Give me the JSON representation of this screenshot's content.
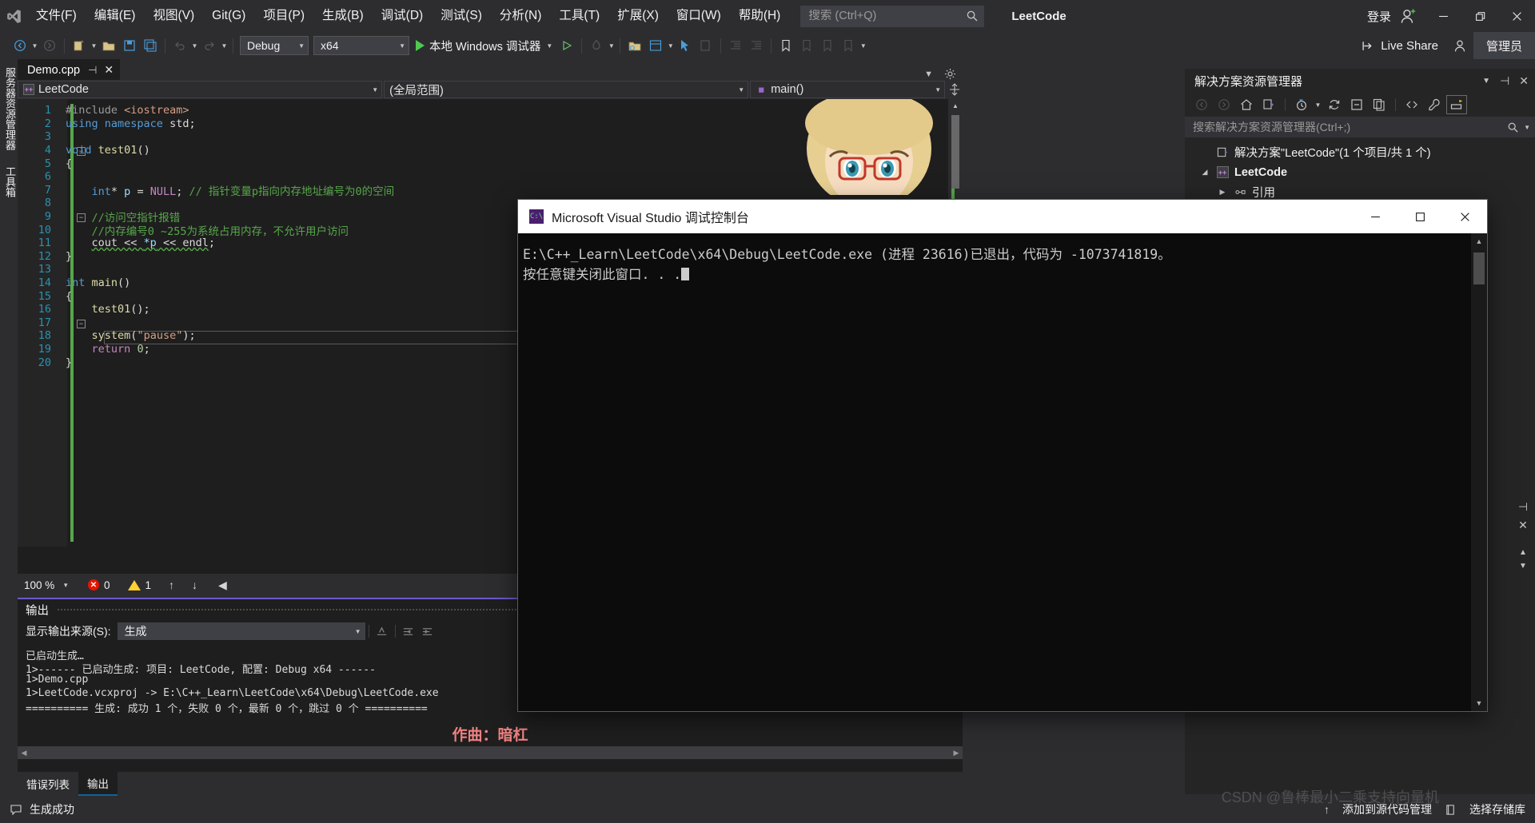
{
  "window": {
    "product": "LeetCode",
    "signin_label": "登录",
    "minimize": "minimize-icon",
    "restore": "restore-icon",
    "close": "close-icon"
  },
  "menubar": {
    "items": [
      {
        "label": "文件(F)"
      },
      {
        "label": "编辑(E)"
      },
      {
        "label": "视图(V)"
      },
      {
        "label": "Git(G)"
      },
      {
        "label": "项目(P)"
      },
      {
        "label": "生成(B)"
      },
      {
        "label": "调试(D)"
      },
      {
        "label": "测试(S)"
      },
      {
        "label": "分析(N)"
      },
      {
        "label": "工具(T)"
      },
      {
        "label": "扩展(X)"
      },
      {
        "label": "窗口(W)"
      },
      {
        "label": "帮助(H)"
      }
    ],
    "search_placeholder": "搜索 (Ctrl+Q)"
  },
  "toolbar": {
    "config": "Debug",
    "platform": "x64",
    "run_label": "本地 Windows 调试器",
    "live_share": "Live Share",
    "admin": "管理员"
  },
  "left_vtabs": [
    {
      "label": "服务器资源管理器"
    },
    {
      "label": "工具箱"
    }
  ],
  "editor": {
    "tab": {
      "name": "Demo.cpp",
      "pin": "pin-icon",
      "close": "close-icon"
    },
    "nav": {
      "project": "LeetCode",
      "scope": "(全局范围)",
      "member": "main()"
    },
    "zoom": "100 %",
    "errors": "0",
    "warnings": "1",
    "code_lines": [
      {
        "n": 1,
        "html": "<span class='pp'>#include</span> <span class='str'>&lt;iostream&gt;</span>"
      },
      {
        "n": 2,
        "html": "<span class='kw'>using</span> <span class='kw'>namespace</span> std;"
      },
      {
        "n": 3,
        "html": ""
      },
      {
        "n": 4,
        "html": "<span class='kw'>void</span> <span class='fn'>test01</span>()"
      },
      {
        "n": 5,
        "html": "{"
      },
      {
        "n": 6,
        "html": ""
      },
      {
        "n": 7,
        "html": "    <span class='kw'>int</span>* <span class='var'>p</span> = <span class='kw2'>NULL</span>; <span class='cmt'>// 指针变量p指向内存地址编号为0的空间</span>"
      },
      {
        "n": 8,
        "html": ""
      },
      {
        "n": 9,
        "html": "    <span class='cmt'>//访问空指针报错</span>"
      },
      {
        "n": 10,
        "html": "    <span class='cmt'>//内存编号0 ~255为系统占用内存，不允许用户访问</span>"
      },
      {
        "n": 11,
        "html": "    <span class='squig'>cout &lt;&lt; <span class='var'>*p</span> &lt;&lt; endl</span>;"
      },
      {
        "n": 12,
        "html": "}"
      },
      {
        "n": 13,
        "html": ""
      },
      {
        "n": 14,
        "html": "<span class='kw'>int</span> <span class='fn'>main</span>()"
      },
      {
        "n": 15,
        "html": "{"
      },
      {
        "n": 16,
        "html": "    <span class='fn'>test01</span>();"
      },
      {
        "n": 17,
        "html": ""
      },
      {
        "n": 18,
        "html": "    <span class='fn'>system</span>(<span class='str'>\"pause\"</span>);"
      },
      {
        "n": 19,
        "html": "    <span class='kw2'>return</span> <span class='num'>0</span>;"
      },
      {
        "n": 20,
        "html": "}"
      }
    ]
  },
  "output": {
    "title": "输出",
    "source_label": "显示输出来源(S):",
    "source_value": "生成",
    "lines": [
      "已启动生成…",
      "1>------ 已启动生成: 项目: LeetCode, 配置: Debug x64 ------",
      "1>Demo.cpp",
      "1>LeetCode.vcxproj -> E:\\C++_Learn\\LeetCode\\x64\\Debug\\LeetCode.exe",
      "========== 生成: 成功 1 个，失败 0 个，最新 0 个，跳过 0 个 =========="
    ],
    "credit": "作曲：暗杠",
    "tabs": [
      {
        "label": "错误列表",
        "active": false
      },
      {
        "label": "输出",
        "active": true
      }
    ]
  },
  "solution_explorer": {
    "title": "解决方案资源管理器",
    "search_placeholder": "搜索解决方案资源管理器(Ctrl+;)",
    "tree": [
      {
        "label": "解决方案\"LeetCode\"(1 个项目/共 1 个)",
        "indent": 0,
        "twisty": "",
        "icon": "solution-icon",
        "bold": false
      },
      {
        "label": "LeetCode",
        "indent": 1,
        "twisty": "▲",
        "icon": "cpp-project-icon",
        "bold": true
      },
      {
        "label": "引用",
        "indent": 2,
        "twisty": "▶",
        "icon": "references-icon",
        "bold": false
      }
    ]
  },
  "console": {
    "title": "Microsoft Visual Studio 调试控制台",
    "lines": [
      "E:\\C++_Learn\\LeetCode\\x64\\Debug\\LeetCode.exe (进程 23616)已退出，代码为 -1073741819。",
      "按任意键关闭此窗口. . ."
    ]
  },
  "statusbar": {
    "state": "生成成功",
    "add_source": "添加到源代码管理",
    "select_repo": "选择存储库"
  },
  "watermark": {
    "line1": "CSDN @鲁棒最小二乘支持向量机",
    "line2": ""
  },
  "colors": {
    "accent": "#0e639c",
    "error": "#e51400",
    "warning": "#ffd02e",
    "success": "#57a64a",
    "chrome": "#2d2d30",
    "editor_bg": "#1e1e1e"
  }
}
